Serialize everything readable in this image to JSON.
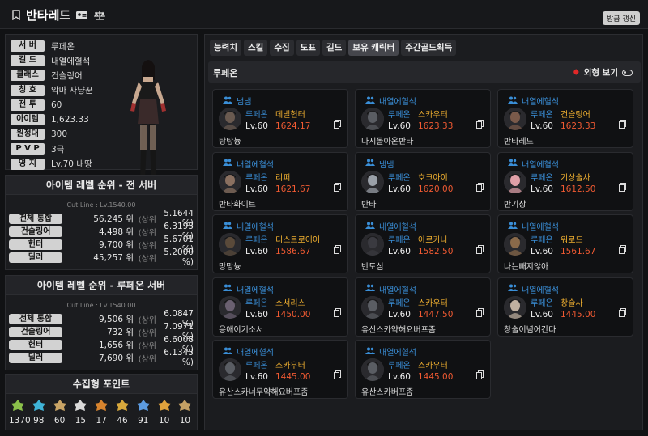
{
  "header": {
    "name": "반타레드",
    "refresh": "방금 갱신"
  },
  "profile": [
    {
      "label": "서 버",
      "value": "루페온"
    },
    {
      "label": "길 드",
      "value": "내열에혈석"
    },
    {
      "label": "클래스",
      "value": "건슬링어"
    },
    {
      "label": "칭 호",
      "value": "악마 사냥꾼"
    },
    {
      "label": "전 투",
      "value": "60"
    },
    {
      "label": "아이템",
      "value": "1,623.33"
    },
    {
      "label": "원정대",
      "value": "300"
    },
    {
      "label": "P V P",
      "value": "3극"
    },
    {
      "label": "영 지",
      "value": "Lv.70 내땅"
    }
  ],
  "rank_all": {
    "title": "아이템 레벨 순위 - 전 서버",
    "cut": "Cut Line : Lv.1540.00",
    "rows": [
      {
        "label": "전체 통합",
        "rank": "56,245 위",
        "sub": "(상위",
        "pct": "5.1644 %)"
      },
      {
        "label": "건슬링어",
        "rank": "4,498 위",
        "sub": "(상위",
        "pct": "6.3193 %)"
      },
      {
        "label": "헌터",
        "rank": "9,700 위",
        "sub": "(상위",
        "pct": "5.6701 %)"
      },
      {
        "label": "딜러",
        "rank": "45,257 위",
        "sub": "(상위",
        "pct": "5.2000 %)"
      }
    ]
  },
  "rank_server": {
    "title": "아이템 레벨 순위 - 루페온 서버",
    "cut": "Cut Line : Lv.1540.00",
    "rows": [
      {
        "label": "전체 통합",
        "rank": "9,506 위",
        "sub": "(상위",
        "pct": "6.0847 %)"
      },
      {
        "label": "건슬링어",
        "rank": "732 위",
        "sub": "(상위",
        "pct": "7.0971 %)"
      },
      {
        "label": "헌터",
        "rank": "1,656 위",
        "sub": "(상위",
        "pct": "6.6008 %)"
      },
      {
        "label": "딜러",
        "rank": "7,690 위",
        "sub": "(상위",
        "pct": "6.1343 %)"
      }
    ]
  },
  "collect": {
    "title": "수집형 포인트",
    "items": [
      {
        "icon": "mokoko-seed-icon",
        "value": "1370",
        "color": "#8ac04a"
      },
      {
        "icon": "island-heart-icon",
        "value": "98",
        "color": "#3fb4d8"
      },
      {
        "icon": "great-art-icon",
        "value": "60",
        "color": "#c9a465"
      },
      {
        "icon": "giant-heart-icon",
        "value": "15",
        "color": "#d9d9d9"
      },
      {
        "icon": "ignea-token-icon",
        "value": "17",
        "color": "#d8842e"
      },
      {
        "icon": "adventure-book-icon",
        "value": "46",
        "color": "#d8a83c"
      },
      {
        "icon": "world-tree-leaf-icon",
        "value": "91",
        "color": "#5c9be0"
      },
      {
        "icon": "orpheus-star-icon",
        "value": "10",
        "color": "#e0a23c"
      },
      {
        "icon": "sea-bounty-icon",
        "value": "10",
        "color": "#c4a064"
      }
    ]
  },
  "tabs": [
    "능력치",
    "스킬",
    "수집",
    "도표",
    "길드",
    "보유 캐릭터",
    "주간골드획득"
  ],
  "active_tab": "보유 캐릭터",
  "server_head": "루페온",
  "appearance_toggle": "외형 보기",
  "characters": [
    {
      "guild": "냄냄",
      "server": "루페온",
      "cls": "데빌헌터",
      "lv": "Lv.60",
      "il": "1624.17",
      "name": "탕탕늉",
      "tone": "#6a5a50"
    },
    {
      "guild": "내열에혈석",
      "server": "루페온",
      "cls": "스카우터",
      "lv": "Lv.60",
      "il": "1623.33",
      "name": "다시돌아온반타",
      "tone": "#5a5d63"
    },
    {
      "guild": "내열에혈석",
      "server": "루페온",
      "cls": "건슬링어",
      "lv": "Lv.60",
      "il": "1623.33",
      "name": "반타레드",
      "tone": "#7a5a4a"
    },
    {
      "guild": "내열에혈석",
      "server": "루페온",
      "cls": "리퍼",
      "lv": "Lv.60",
      "il": "1621.67",
      "name": "반타화이트",
      "tone": "#8a7060"
    },
    {
      "guild": "냄냄",
      "server": "루페온",
      "cls": "호크아이",
      "lv": "Lv.60",
      "il": "1620.00",
      "name": "반타",
      "tone": "#9aa0a8"
    },
    {
      "guild": "내열에혈석",
      "server": "루페온",
      "cls": "기상술사",
      "lv": "Lv.60",
      "il": "1612.50",
      "name": "반기상",
      "tone": "#e0a0a8"
    },
    {
      "guild": "내열에혈석",
      "server": "루페온",
      "cls": "디스트로이어",
      "lv": "Lv.60",
      "il": "1586.67",
      "name": "망망늉",
      "tone": "#5a4a3a"
    },
    {
      "guild": "내열에혈석",
      "server": "루페온",
      "cls": "아르카나",
      "lv": "Lv.60",
      "il": "1582.50",
      "name": "반도심",
      "tone": "#3a3a40"
    },
    {
      "guild": "내열에혈석",
      "server": "루페온",
      "cls": "워로드",
      "lv": "Lv.60",
      "il": "1561.67",
      "name": "나는빼지않아",
      "tone": "#8a6a4a"
    },
    {
      "guild": "내열에혈석",
      "server": "루페온",
      "cls": "소서리스",
      "lv": "Lv.60",
      "il": "1450.00",
      "name": "응애이기소서",
      "tone": "#6a6070"
    },
    {
      "guild": "내열에혈석",
      "server": "루페온",
      "cls": "스카우터",
      "lv": "Lv.60",
      "il": "1447.50",
      "name": "유산스카약해요버프좀",
      "tone": "#5a5d63"
    },
    {
      "guild": "내열에혈석",
      "server": "루페온",
      "cls": "창술사",
      "lv": "Lv.60",
      "il": "1445.00",
      "name": "창술이념어간다",
      "tone": "#c0b0a0"
    },
    {
      "guild": "내열에혈석",
      "server": "루페온",
      "cls": "스카우터",
      "lv": "Lv.60",
      "il": "1445.00",
      "name": "유산스카너무약해요버프좀",
      "tone": "#5a5d63"
    },
    {
      "guild": "내열에혈석",
      "server": "루페온",
      "cls": "스카우터",
      "lv": "Lv.60",
      "il": "1445.00",
      "name": "유산스카버프좀",
      "tone": "#5a5d63"
    }
  ]
}
